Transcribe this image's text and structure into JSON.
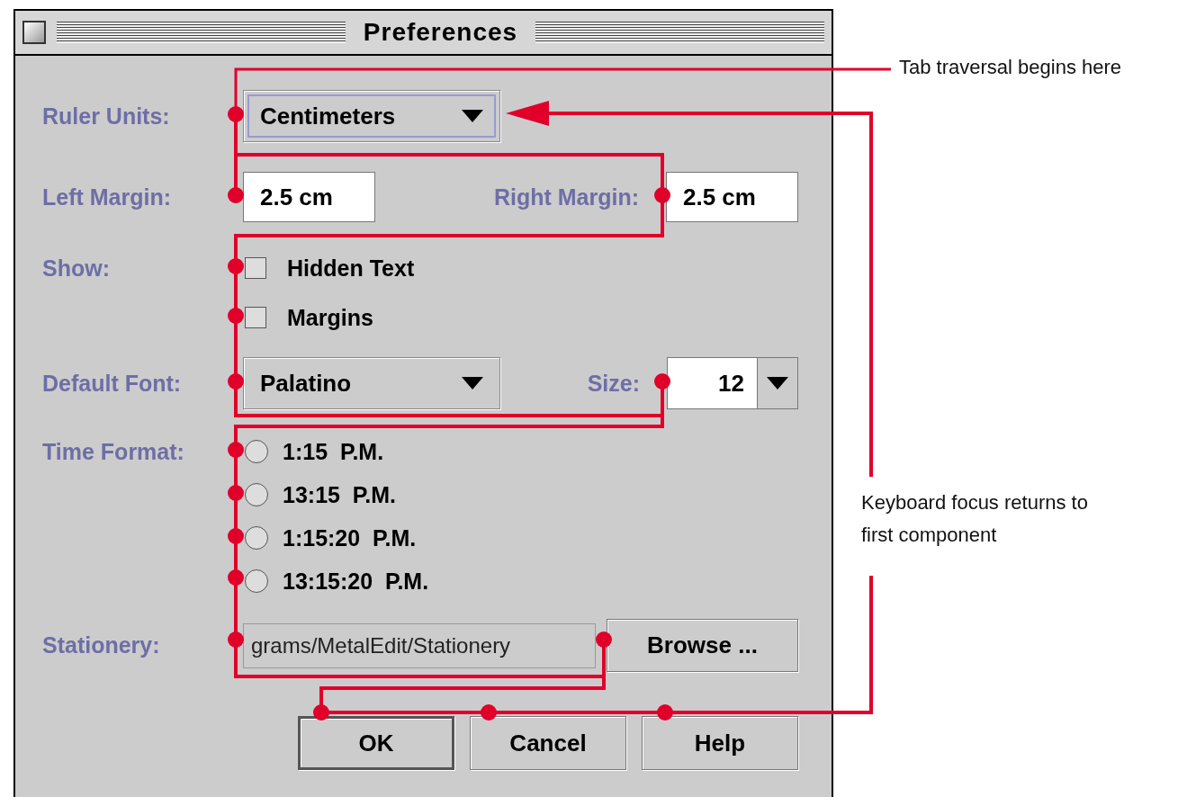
{
  "window": {
    "title": "Preferences"
  },
  "form": {
    "ruler_units": {
      "label": "Ruler Units:",
      "value": "Centimeters",
      "focused": true
    },
    "left_margin": {
      "label": "Left Margin:",
      "value": "2.5 cm"
    },
    "right_margin": {
      "label": "Right Margin:",
      "value": "2.5 cm"
    },
    "show": {
      "label": "Show:",
      "options": [
        {
          "label": "Hidden Text",
          "checked": false
        },
        {
          "label": "Margins",
          "checked": false
        }
      ]
    },
    "default_font": {
      "label": "Default Font:",
      "value": "Palatino"
    },
    "size": {
      "label": "Size:",
      "value": "12"
    },
    "time_format": {
      "label": "Time Format:",
      "options": [
        {
          "label": "1:15  P.M.",
          "selected": false
        },
        {
          "label": "13:15  P.M.",
          "selected": false
        },
        {
          "label": "1:15:20  P.M.",
          "selected": false
        },
        {
          "label": "13:15:20  P.M.",
          "selected": false
        }
      ]
    },
    "stationery": {
      "label": "Stationery:",
      "value": "grams/MetalEdit/Stationery",
      "browse": "Browse ..."
    }
  },
  "buttons": [
    {
      "label": "OK",
      "default": true
    },
    {
      "label": "Cancel",
      "default": false
    },
    {
      "label": "Help",
      "default": false
    }
  ],
  "annotations": [
    {
      "text": "Tab traversal begins here"
    },
    {
      "text": "Keyboard focus returns to first component"
    }
  ]
}
